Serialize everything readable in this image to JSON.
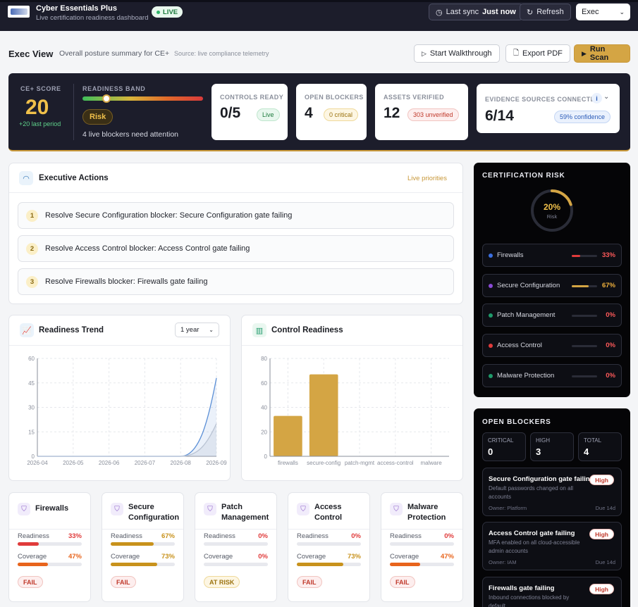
{
  "app": {
    "title": "Cyber Essentials Plus",
    "subtitle": "Live certification readiness dashboard",
    "live": "LIVE"
  },
  "topbar": {
    "last_sync_label": "Last sync",
    "last_sync_value": "Just now",
    "refresh": "Refresh",
    "view_select": "Exec"
  },
  "header": {
    "title": "Exec View",
    "subtitle": "Overall posture summary for CE+",
    "source": "Source: live compliance telemetry",
    "walkthrough": "Start Walkthrough",
    "export": "Export PDF",
    "run_scan": "Run Scan"
  },
  "hero": {
    "score_label": "CE+ SCORE",
    "score": "20",
    "score_delta": "+20 last period",
    "band_label": "READINESS BAND",
    "band_level": 0.2,
    "band": "Risk",
    "band_note": "4 live blockers need attention",
    "kpis": [
      {
        "title": "CONTROLS READY",
        "value": "0/5",
        "tag": "Live"
      },
      {
        "title": "OPEN BLOCKERS",
        "value": "4",
        "tag": "0 critical"
      },
      {
        "title": "ASSETS VERIFIED",
        "value": "12",
        "tag": "303 unverified"
      },
      {
        "title": "EVIDENCE SOURCES CONNECTED",
        "value": "6/14",
        "tag": "59% confidence",
        "info": "i"
      }
    ]
  },
  "actions": {
    "title": "Executive Actions",
    "badge": "Live priorities",
    "items": [
      {
        "n": "1",
        "text": "Resolve Secure Configuration blocker: Secure Configuration gate failing"
      },
      {
        "n": "2",
        "text": "Resolve Access Control blocker: Access Control gate failing"
      },
      {
        "n": "3",
        "text": "Resolve Firewalls blocker: Firewalls gate failing"
      }
    ]
  },
  "trend": {
    "title": "Readiness Trend",
    "range": "1 year"
  },
  "readiness": {
    "title": "Control Readiness"
  },
  "chart_data": [
    {
      "type": "area",
      "title": "Readiness Trend",
      "x": [
        "2026-04",
        "2026-05",
        "2026-06",
        "2026-07",
        "2026-08",
        "2026-09"
      ],
      "yticks": [
        "0",
        "15",
        "30",
        "45",
        "60"
      ],
      "ylim": [
        0,
        60
      ],
      "grid": true,
      "series": [
        {
          "values": [
            0,
            0,
            0,
            0,
            0,
            48
          ],
          "color": "#5b8fd6"
        },
        {
          "values": [
            0,
            0,
            0,
            0,
            0,
            20
          ],
          "color": "#b9c3d3"
        }
      ]
    },
    {
      "type": "bar",
      "title": "Control Readiness",
      "categories": [
        "firewalls",
        "secure-config",
        "patch-mgmt",
        "access-control",
        "malware"
      ],
      "values": [
        33,
        67,
        0,
        0,
        0
      ],
      "yticks": [
        "0",
        "20",
        "40",
        "60",
        "80"
      ],
      "ylim": [
        0,
        80
      ],
      "grid": true,
      "color": "#d4a544"
    }
  ],
  "cert_risk": {
    "title": "CERTIFICATION RISK",
    "gauge_value": "20%",
    "gauge_label": "Risk",
    "gauge_fraction": 0.2,
    "rows": [
      {
        "name": "Firewalls",
        "pct": "33%",
        "level": 0.33,
        "dot": "#3b6fe0",
        "bar": "#e03b3b",
        "pc_color": "#ff5a5a"
      },
      {
        "name": "Secure Configuration",
        "pct": "67%",
        "level": 0.67,
        "dot": "#8a4bd6",
        "bar": "#d4a544",
        "pc_color": "#f0b13c"
      },
      {
        "name": "Patch Management",
        "pct": "0%",
        "level": 0,
        "dot": "#1f9a6a",
        "bar": "#e03b3b",
        "pc_color": "#ff5a5a"
      },
      {
        "name": "Access Control",
        "pct": "0%",
        "level": 0,
        "dot": "#e03b3b",
        "bar": "#e03b3b",
        "pc_color": "#ff5a5a"
      },
      {
        "name": "Malware Protection",
        "pct": "0%",
        "level": 0,
        "dot": "#1f9a6a",
        "bar": "#e03b3b",
        "pc_color": "#ff5a5a"
      }
    ]
  },
  "blockers": {
    "title": "OPEN BLOCKERS",
    "counts": [
      {
        "label": "CRITICAL",
        "value": "0"
      },
      {
        "label": "HIGH",
        "value": "3"
      },
      {
        "label": "TOTAL",
        "value": "4"
      }
    ],
    "items": [
      {
        "title": "Secure Configuration gate failing",
        "desc": "Default passwords changed on all accounts",
        "owner": "Owner: Platform",
        "due": "Due 14d",
        "sev": "High"
      },
      {
        "title": "Access Control gate failing",
        "desc": "MFA enabled on all cloud-accessible admin accounts",
        "owner": "Owner: IAM",
        "due": "Due 14d",
        "sev": "High"
      },
      {
        "title": "Firewalls gate failing",
        "desc": "Inbound connections blocked by default",
        "sev": "High"
      }
    ]
  },
  "controls": [
    {
      "name": "Firewalls",
      "readiness": "33%",
      "coverage": "47%",
      "r": 0.33,
      "c": 0.47,
      "status": "FAIL",
      "kind": "fail"
    },
    {
      "name": "Secure Configuration",
      "readiness": "67%",
      "coverage": "73%",
      "r": 0.67,
      "c": 0.73,
      "status": "FAIL",
      "kind": "fail"
    },
    {
      "name": "Patch Management",
      "readiness": "0%",
      "coverage": "0%",
      "r": 0,
      "c": 0,
      "status": "AT RISK",
      "kind": "risk"
    },
    {
      "name": "Access Control",
      "readiness": "0%",
      "coverage": "73%",
      "r": 0,
      "c": 0.73,
      "status": "FAIL",
      "kind": "fail"
    },
    {
      "name": "Malware Protection",
      "readiness": "0%",
      "coverage": "47%",
      "r": 0,
      "c": 0.47,
      "status": "FAIL",
      "kind": "fail"
    }
  ],
  "labels": {
    "readiness": "Readiness",
    "coverage": "Coverage"
  },
  "colors": {
    "accent": "#d4a544",
    "dark": "#1c1d2b",
    "fail": "#e03b3b",
    "ok": "#1d7a3e"
  }
}
